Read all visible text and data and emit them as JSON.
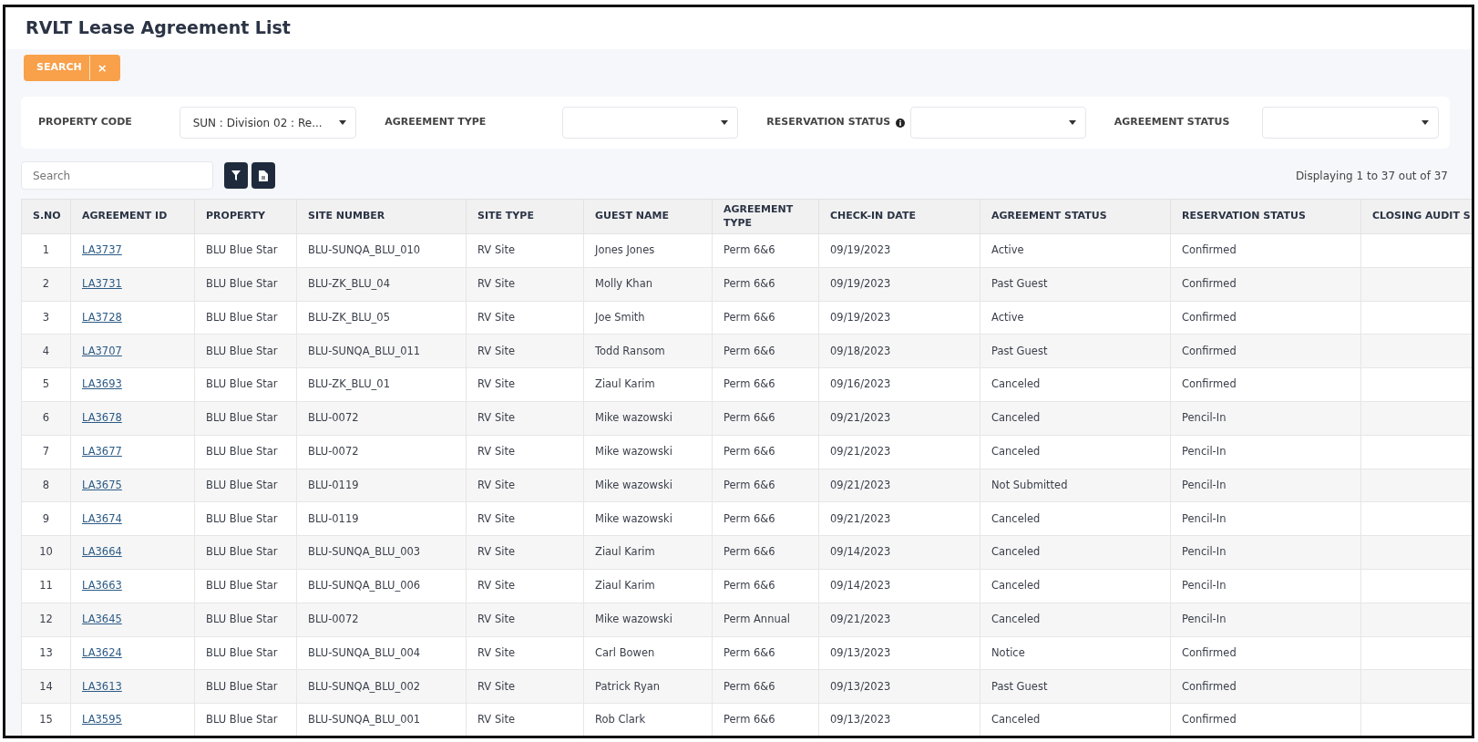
{
  "page": {
    "title": "RVLT Lease Agreement List"
  },
  "search_tag": {
    "label": "SEARCH",
    "close": "×"
  },
  "filters": [
    {
      "label": "PROPERTY CODE",
      "value": "SUN : Division 02 : Re...",
      "info": false
    },
    {
      "label": "AGREEMENT TYPE",
      "info": false
    },
    {
      "label": "RESERVATION STATUS",
      "info": true
    },
    {
      "label": "AGREEMENT STATUS",
      "info": false
    }
  ],
  "search": {
    "placeholder": "Search"
  },
  "display_count": "Displaying 1 to 37 out of 37",
  "table": {
    "columns": [
      "S.NO",
      "AGREEMENT ID",
      "PROPERTY",
      "SITE NUMBER",
      "SITE TYPE",
      "GUEST NAME",
      "AGREEMENT TYPE",
      "CHECK-IN DATE",
      "AGREEMENT STATUS",
      "RESERVATION STATUS",
      "CLOSING AUDIT S"
    ],
    "rows": [
      [
        "1",
        "LA3737",
        "BLU Blue Star",
        "BLU-SUNQA_BLU_010",
        "RV Site",
        "Jones Jones",
        "Perm 6&6",
        "09/19/2023",
        "Active",
        "Confirmed"
      ],
      [
        "2",
        "LA3731",
        "BLU Blue Star",
        "BLU-ZK_BLU_04",
        "RV Site",
        "Molly Khan",
        "Perm 6&6",
        "09/19/2023",
        "Past Guest",
        "Confirmed"
      ],
      [
        "3",
        "LA3728",
        "BLU Blue Star",
        "BLU-ZK_BLU_05",
        "RV Site",
        "Joe Smith",
        "Perm 6&6",
        "09/19/2023",
        "Active",
        "Confirmed"
      ],
      [
        "4",
        "LA3707",
        "BLU Blue Star",
        "BLU-SUNQA_BLU_011",
        "RV Site",
        "Todd Ransom",
        "Perm 6&6",
        "09/18/2023",
        "Past Guest",
        "Confirmed"
      ],
      [
        "5",
        "LA3693",
        "BLU Blue Star",
        "BLU-ZK_BLU_01",
        "RV Site",
        "Ziaul Karim",
        "Perm 6&6",
        "09/16/2023",
        "Canceled",
        "Confirmed"
      ],
      [
        "6",
        "LA3678",
        "BLU Blue Star",
        "BLU-0072",
        "RV Site",
        "Mike wazowski",
        "Perm 6&6",
        "09/21/2023",
        "Canceled",
        "Pencil-In"
      ],
      [
        "7",
        "LA3677",
        "BLU Blue Star",
        "BLU-0072",
        "RV Site",
        "Mike wazowski",
        "Perm 6&6",
        "09/21/2023",
        "Canceled",
        "Pencil-In"
      ],
      [
        "8",
        "LA3675",
        "BLU Blue Star",
        "BLU-0119",
        "RV Site",
        "Mike wazowski",
        "Perm 6&6",
        "09/21/2023",
        "Not Submitted",
        "Pencil-In"
      ],
      [
        "9",
        "LA3674",
        "BLU Blue Star",
        "BLU-0119",
        "RV Site",
        "Mike wazowski",
        "Perm 6&6",
        "09/21/2023",
        "Canceled",
        "Pencil-In"
      ],
      [
        "10",
        "LA3664",
        "BLU Blue Star",
        "BLU-SUNQA_BLU_003",
        "RV Site",
        "Ziaul Karim",
        "Perm 6&6",
        "09/14/2023",
        "Canceled",
        "Pencil-In"
      ],
      [
        "11",
        "LA3663",
        "BLU Blue Star",
        "BLU-SUNQA_BLU_006",
        "RV Site",
        "Ziaul Karim",
        "Perm 6&6",
        "09/14/2023",
        "Canceled",
        "Pencil-In"
      ],
      [
        "12",
        "LA3645",
        "BLU Blue Star",
        "BLU-0072",
        "RV Site",
        "Mike wazowski",
        "Perm Annual",
        "09/21/2023",
        "Canceled",
        "Pencil-In"
      ],
      [
        "13",
        "LA3624",
        "BLU Blue Star",
        "BLU-SUNQA_BLU_004",
        "RV Site",
        "Carl Bowen",
        "Perm 6&6",
        "09/13/2023",
        "Notice",
        "Confirmed"
      ],
      [
        "14",
        "LA3613",
        "BLU Blue Star",
        "BLU-SUNQA_BLU_002",
        "RV Site",
        "Patrick Ryan",
        "Perm 6&6",
        "09/13/2023",
        "Past Guest",
        "Confirmed"
      ],
      [
        "15",
        "LA3595",
        "BLU Blue Star",
        "BLU-SUNQA_BLU_001",
        "RV Site",
        "Rob Clark",
        "Perm 6&6",
        "09/13/2023",
        "Canceled",
        "Confirmed"
      ]
    ]
  }
}
